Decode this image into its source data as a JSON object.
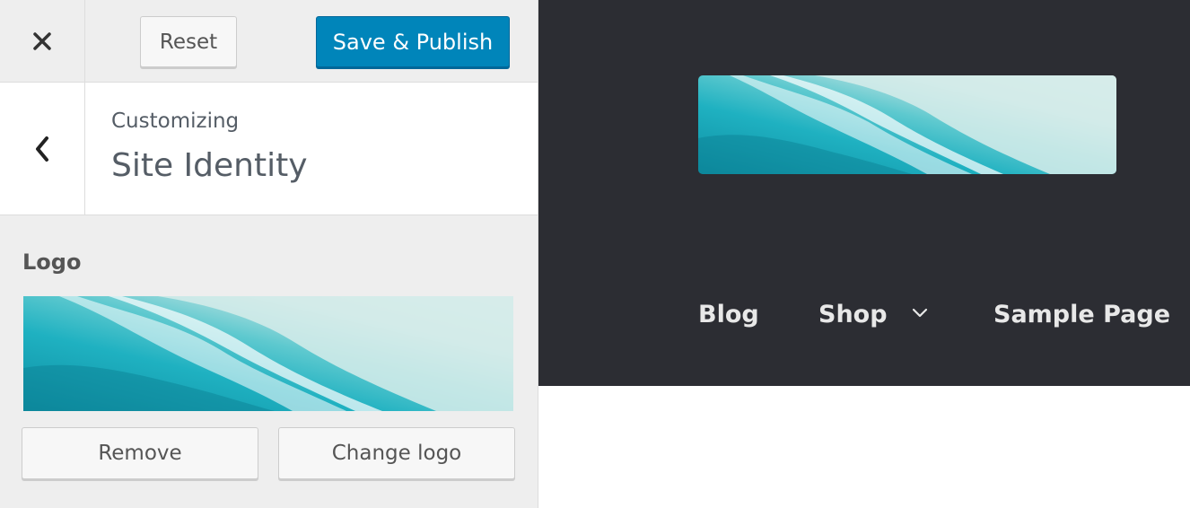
{
  "topbar": {
    "close_icon": "close-icon",
    "reset_label": "Reset",
    "publish_label": "Save & Publish"
  },
  "section": {
    "back_icon": "chevron-left-icon",
    "customizing_label": "Customizing",
    "title": "Site Identity"
  },
  "logo_control": {
    "label": "Logo",
    "remove_label": "Remove",
    "change_label": "Change logo"
  },
  "site_preview": {
    "nav": [
      {
        "label": "Blog"
      },
      {
        "label": "Shop",
        "icon": "chevron-down-icon"
      },
      {
        "label": "Sample Page"
      }
    ]
  },
  "colors": {
    "sidebar_bg": "#eeeeee",
    "primary_button": "#0085ba",
    "site_header_bg": "#2c2d33",
    "text_muted": "#555d66"
  }
}
